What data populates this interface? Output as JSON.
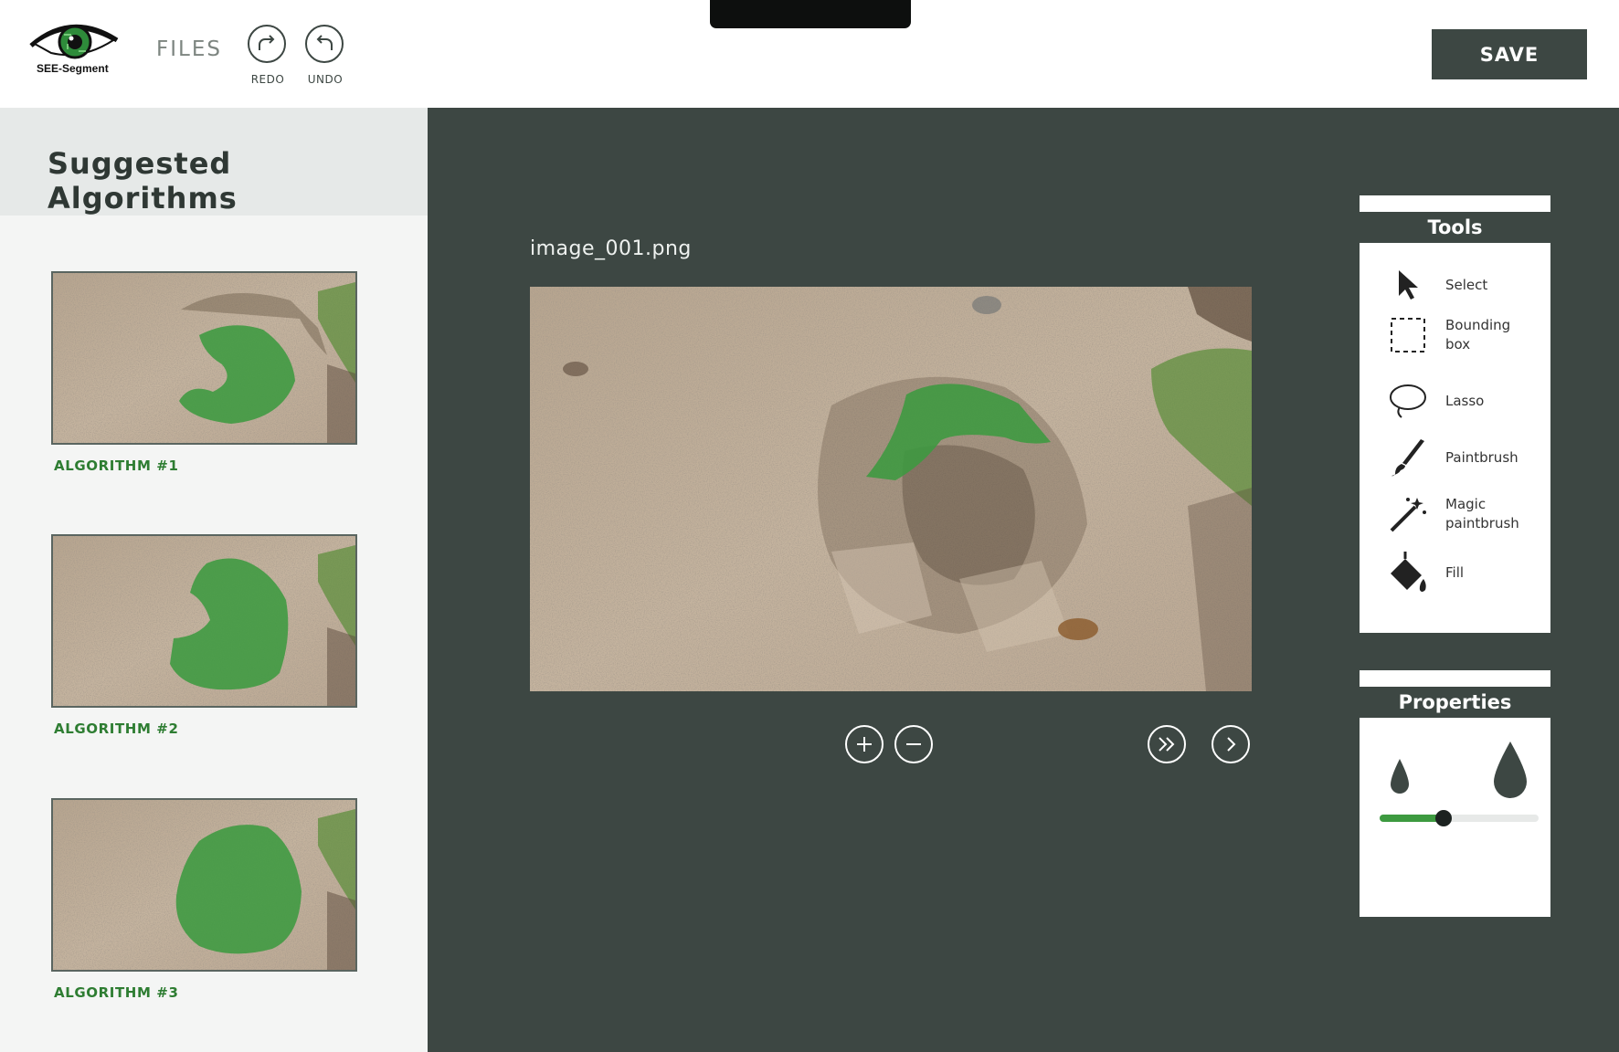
{
  "header": {
    "logo_text": "SEE-Segment",
    "files_label": "FILES",
    "redo_label": "REDO",
    "undo_label": "UNDO",
    "save_label": "SAVE"
  },
  "sidebar": {
    "title": "Suggested Algorithms",
    "algorithms": [
      {
        "label": "ALGORITHM #1"
      },
      {
        "label": "ALGORITHM #2"
      },
      {
        "label": "ALGORITHM #3"
      }
    ]
  },
  "main": {
    "filename": "image_001.png"
  },
  "tools": {
    "title": "Tools",
    "items": [
      {
        "label": "Select",
        "icon": "cursor-arrow-icon"
      },
      {
        "label": "Bounding box",
        "icon": "bounding-box-icon"
      },
      {
        "label": "Lasso",
        "icon": "lasso-icon"
      },
      {
        "label": "Paintbrush",
        "icon": "paintbrush-icon"
      },
      {
        "label": "Magic paintbrush",
        "icon": "magic-wand-icon"
      },
      {
        "label": "Fill",
        "icon": "paint-bucket-icon"
      }
    ]
  },
  "properties": {
    "title": "Properties",
    "brush_size_fraction": 0.4
  },
  "colors": {
    "dark": "#3d4743",
    "accent_green": "#2e7d32",
    "mask_green": "#3c9a40",
    "sidebar_bg": "#f4f5f4"
  }
}
